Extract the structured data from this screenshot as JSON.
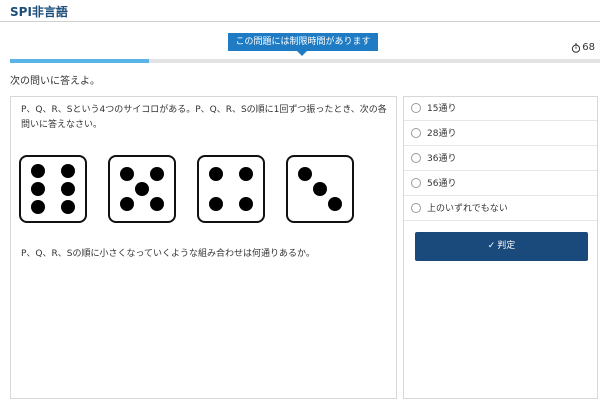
{
  "header": {
    "title": "SPI非言語"
  },
  "timelimit_notice": "この問題には制限時間があります",
  "timer": {
    "value": "68",
    "icon": "stopwatch-icon"
  },
  "progress": {
    "fraction": 0.235
  },
  "instruction": "次の問いに答えよ。",
  "question": {
    "text": "P、Q、R、Sという4つのサイコロがある。P、Q、R、Sの順に1回ずつ振ったとき、次の各問いに答えなさい。",
    "dice": [
      6,
      5,
      4,
      3
    ],
    "prompt": "P、Q、R、Sの順に小さくなっていくような組み合わせは何通りあるか。"
  },
  "answers": {
    "options": [
      "15通り",
      "28通り",
      "36通り",
      "56通り",
      "上のいずれでもない"
    ],
    "judge_label": "判定",
    "judge_icon": "check-icon"
  },
  "colors": {
    "accent": "#1f7cc4",
    "button": "#1a4a7c",
    "title": "#1d4e79",
    "progress": "#5ab4e6"
  }
}
